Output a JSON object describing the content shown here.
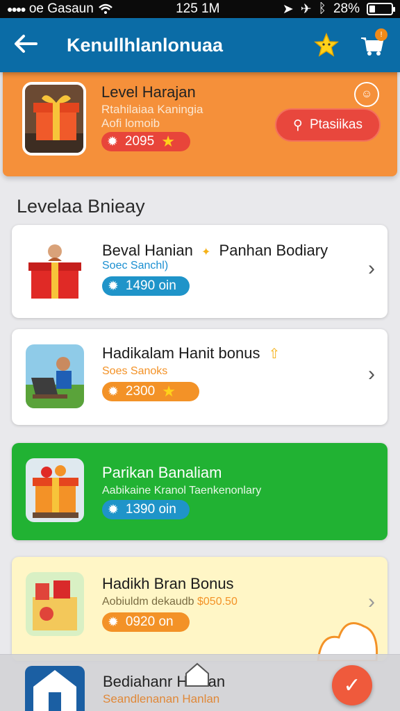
{
  "status_bar": {
    "carrier": "oe Gasaun",
    "time": "125 1M",
    "battery_text": "28%",
    "battery_level": 0.28
  },
  "header": {
    "back_icon": "back-arrow-icon",
    "title": "Kenullhlanlonuaa",
    "star_icon": "star-icon",
    "cart_icon": "cart-icon",
    "cart_badge": "!"
  },
  "featured": {
    "title": "Level Harajan",
    "subtitle_1": "Rtahilaiaa Kaningia",
    "subtitle_2": "Aofi lomoib",
    "points": "2095",
    "button_label": "Ptasiikas",
    "colors": {
      "background": "#f5903a",
      "button": "#e8473d"
    }
  },
  "section_title": "Levelaa Bnieay",
  "items": [
    {
      "title": "Beval Hanian",
      "title_extra": "Panhan Bodiary",
      "subtitle": "Soec Sanchl)",
      "points": "1490 oin",
      "pill_color": "#1f94c9",
      "bg": "#ffffff",
      "has_star": false
    },
    {
      "title": "Hadikalam Hanit bonus",
      "subtitle": "Soes Sanoks",
      "points": "2300",
      "pill_color": "#f39227",
      "bg": "#ffffff",
      "has_star": true
    },
    {
      "title": "Parikan Banaliam",
      "subtitle": "Aabikaine Kranol Taenkenonlary",
      "points": "1390 oin",
      "pill_color": "#1f94c9",
      "bg": "#21b233",
      "has_star": false
    },
    {
      "title": "Hadikh Bran Bonus",
      "subtitle": "Aobiuldm dekaudb",
      "subtitle_price": "$050.50",
      "points": "0920 on",
      "pill_color": "#f39227",
      "bg": "#fff6c6",
      "has_star": false
    }
  ],
  "bottom_bar": {
    "title": "Bediahanr Hanian",
    "subtitle": "Seandlenanan Hanlan",
    "fab_icon": "check-icon"
  }
}
